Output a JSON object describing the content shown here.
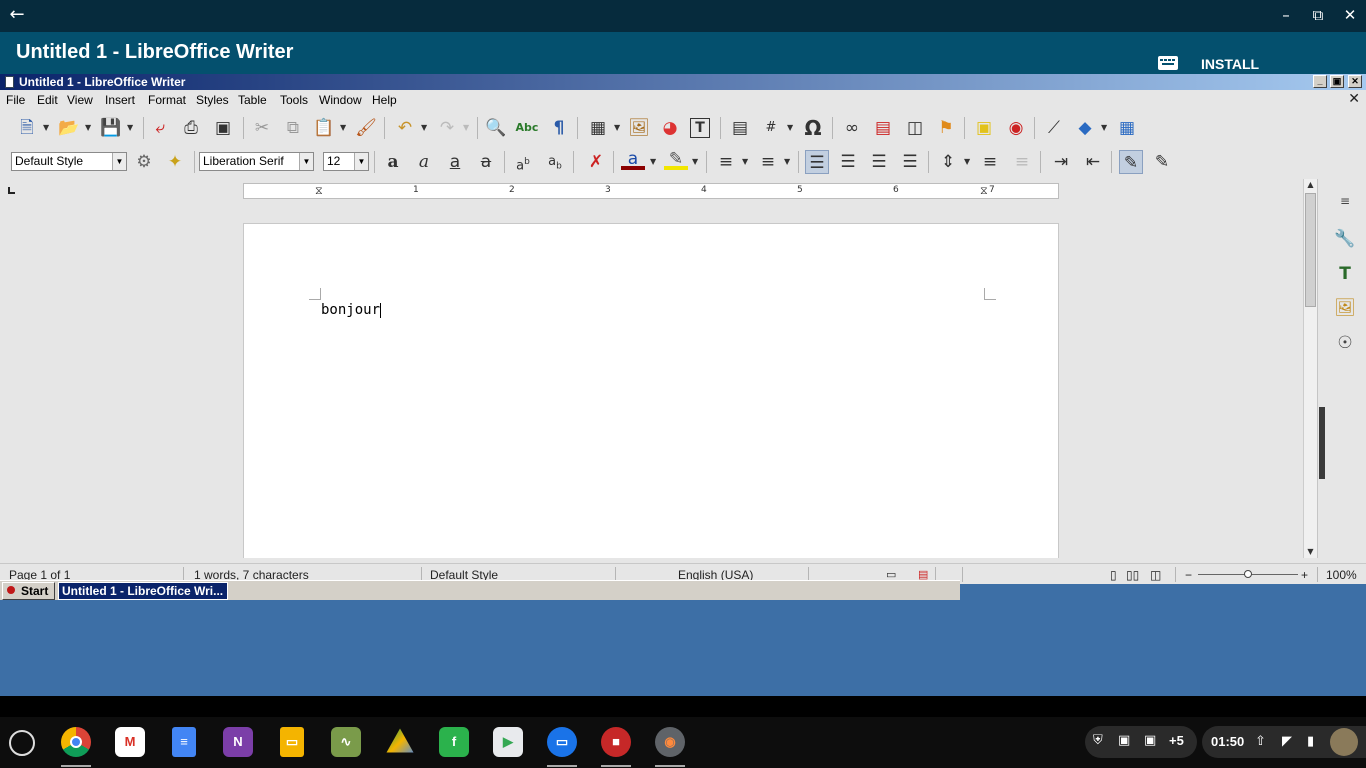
{
  "cros": {
    "app_title": "Untitled 1 - LibreOffice Writer",
    "install_label": "INSTALL APPLICATION..."
  },
  "window": {
    "title": "Untitled 1 - LibreOffice Writer"
  },
  "menu": [
    "File",
    "Edit",
    "View",
    "Insert",
    "Format",
    "Styles",
    "Table",
    "Tools",
    "Window",
    "Help"
  ],
  "formatting": {
    "paragraph_style": "Default Style",
    "font_name": "Liberation Serif",
    "font_size": "12"
  },
  "document": {
    "text": "bonjour"
  },
  "ruler": {
    "numbers": [
      "1",
      "2",
      "3",
      "4",
      "5",
      "6",
      "7"
    ]
  },
  "status": {
    "page": "Page 1 of 1",
    "words": "1 words, 7 characters",
    "style": "Default Style",
    "language": "English (USA)",
    "zoom": "100%",
    "zoom_percent": 100
  },
  "xtaskbar": {
    "start_label": "Start",
    "task_label": "Untitled 1 - LibreOffice Wri..."
  },
  "shelf": {
    "apps": [
      "chrome",
      "gmail",
      "docs",
      "onenote",
      "slides",
      "xpaint",
      "drive",
      "feedly",
      "play-store",
      "files",
      "screen-recorder",
      "rdp-client"
    ],
    "tray_count": "+5",
    "time": "01:50"
  }
}
